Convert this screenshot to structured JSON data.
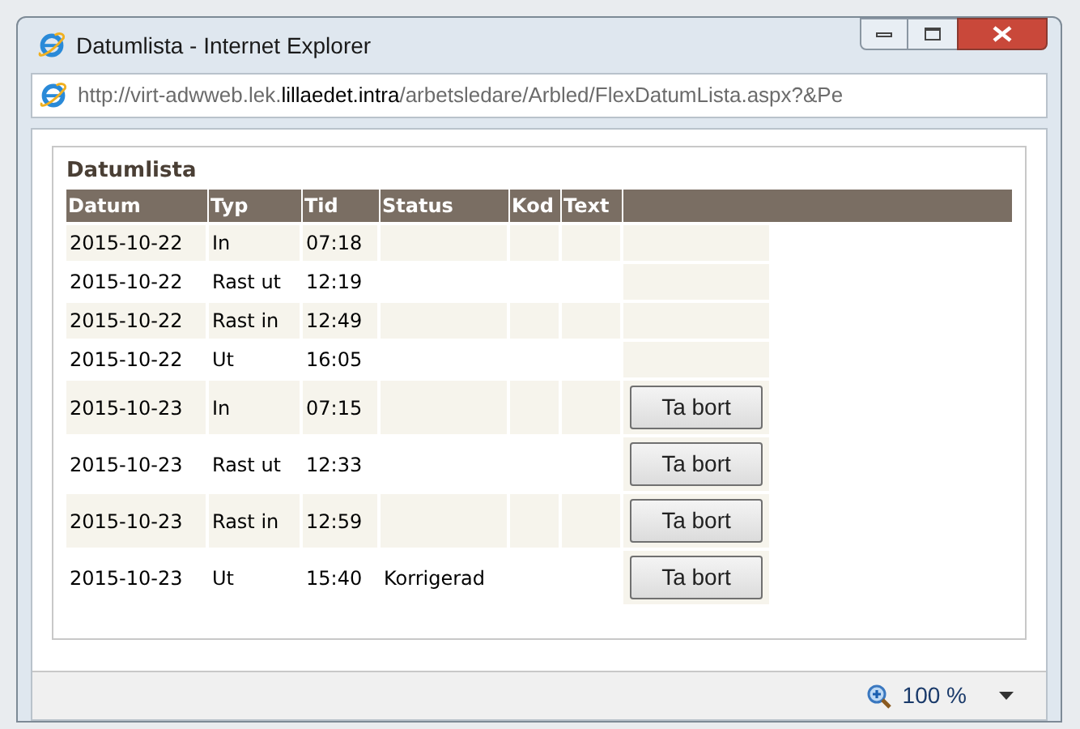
{
  "window": {
    "title": "Datumlista - Internet Explorer"
  },
  "address_bar": {
    "url": "http://virt-adwweb.lek.**lillaedet.intra**/arbetsledare/Arbled/FlexDatumLista.aspx?&Pe"
  },
  "panel": {
    "title": "Datumlista"
  },
  "table": {
    "columns": [
      "Datum",
      "Typ",
      "Tid",
      "Status",
      "Kod",
      "Text"
    ],
    "rows": [
      {
        "cells": [
          "2015-10-22",
          "In",
          "07:18",
          "",
          "",
          ""
        ]
      },
      {
        "cells": [
          "2015-10-22",
          "Rast ut",
          "12:19",
          "",
          "",
          ""
        ]
      },
      {
        "cells": [
          "2015-10-22",
          "Rast in",
          "12:49",
          "",
          "",
          ""
        ]
      },
      {
        "cells": [
          "2015-10-22",
          "Ut",
          "16:05",
          "",
          "",
          ""
        ]
      },
      {
        "cells": [
          "2015-10-23",
          "In",
          "07:15",
          "",
          "",
          ""
        ],
        "action": "Ta bort"
      },
      {
        "cells": [
          "2015-10-23",
          "Rast ut",
          "12:33",
          "",
          "",
          ""
        ],
        "action": "Ta bort"
      },
      {
        "cells": [
          "2015-10-23",
          "Rast in",
          "12:59",
          "",
          "",
          ""
        ],
        "action": "Ta bort"
      },
      {
        "cells": [
          "2015-10-23",
          "Ut",
          "15:40",
          "Korrigerad",
          "",
          ""
        ],
        "action": "Ta bort"
      }
    ]
  },
  "status_bar": {
    "zoom": "100 %"
  }
}
